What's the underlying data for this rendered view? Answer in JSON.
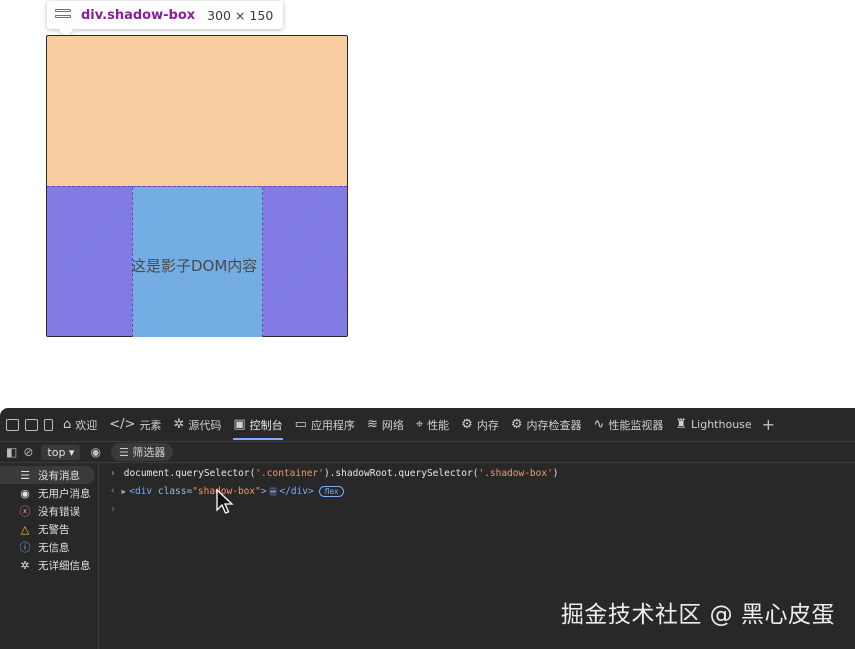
{
  "tooltip": {
    "element": "div.shadow-box",
    "size": "300 × 150"
  },
  "page": {
    "shadow_text": "这是影子DOM内容"
  },
  "devtools": {
    "tabs": [
      {
        "icon": "home-icon",
        "glyph": "⌂",
        "label": "欢迎"
      },
      {
        "icon": "code-icon",
        "glyph": "</>",
        "label": "元素"
      },
      {
        "icon": "bug-icon",
        "glyph": "✲",
        "label": "源代码"
      },
      {
        "icon": "console-icon",
        "glyph": "▣",
        "label": "控制台",
        "active": true
      },
      {
        "icon": "app-icon",
        "glyph": "▭",
        "label": "应用程序"
      },
      {
        "icon": "wifi-icon",
        "glyph": "≋",
        "label": "网络"
      },
      {
        "icon": "gauge-icon",
        "glyph": "⌖",
        "label": "性能"
      },
      {
        "icon": "gear-icon",
        "glyph": "⚙",
        "label": "内存"
      },
      {
        "icon": "gear-icon",
        "glyph": "⚙",
        "label": "内存检查器"
      },
      {
        "icon": "pulse-icon",
        "glyph": "∿",
        "label": "性能监视器"
      },
      {
        "icon": "lighthouse-icon",
        "glyph": "♜",
        "label": "Lighthouse"
      }
    ],
    "context": "top",
    "filter_placeholder": "筛选器",
    "sidebar": [
      {
        "icon": "list-icon",
        "glyph": "☰",
        "label": "没有消息",
        "selected": true
      },
      {
        "icon": "user-icon",
        "glyph": "◉",
        "label": "无用户消息"
      },
      {
        "icon": "error-icon",
        "glyph": "ⓧ",
        "label": "没有错误"
      },
      {
        "icon": "warning-icon",
        "glyph": "△",
        "label": "无警告"
      },
      {
        "icon": "info-icon",
        "glyph": "ⓘ",
        "label": "无信息"
      },
      {
        "icon": "bug-icon",
        "glyph": "✲",
        "label": "无详细信息"
      }
    ],
    "console": {
      "command": {
        "p1": "document.",
        "m1": "querySelector",
        "p2": "(",
        "s1": "'.container'",
        "p3": ").",
        "m2": "shadowRoot",
        "p4": ".",
        "m3": "querySelector",
        "p5": "(",
        "s2": "'.shadow-box'",
        "p6": ")"
      },
      "result": {
        "open_tag": "<div",
        "attr_name": "class=",
        "attr_value": "\"shadow-box\"",
        "close_open": ">",
        "ellipsis": "⋯",
        "close_tag": "</div>",
        "badge": "flex"
      }
    }
  },
  "watermark": "掘金技术社区 @ 黑心皮蛋",
  "colors": {
    "box": "#f8cda0",
    "shadow_highlight": "#7c7ee5",
    "content": "#74ade4",
    "accent": "#7cacf8"
  }
}
